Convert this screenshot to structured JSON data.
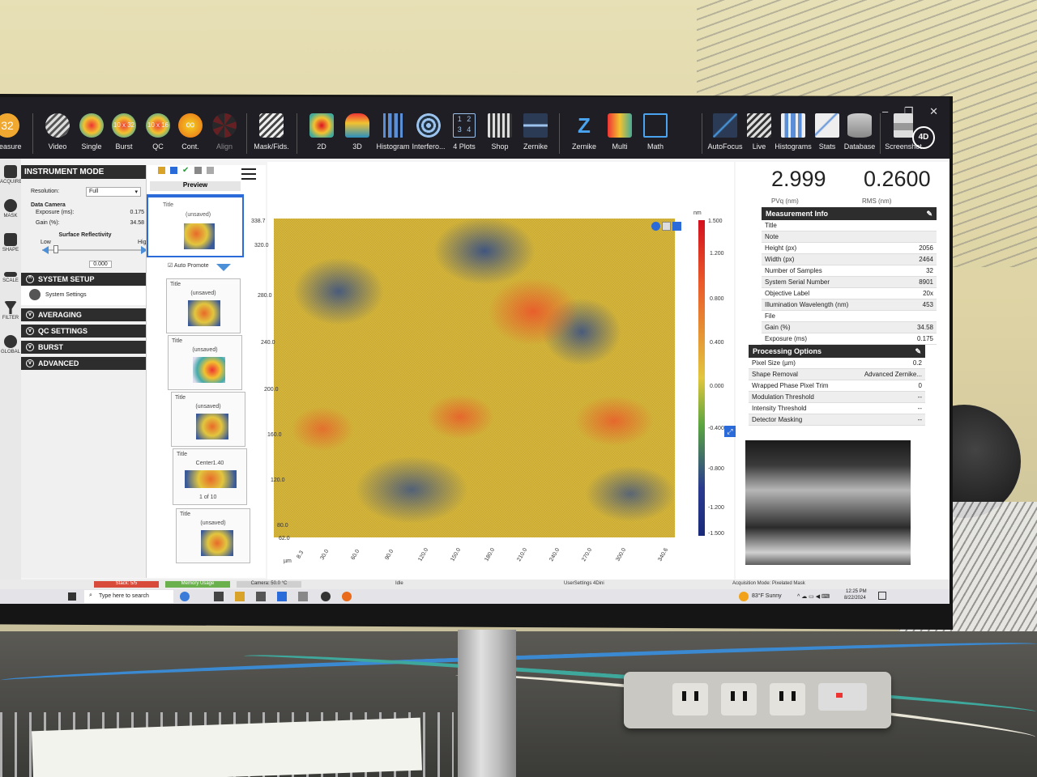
{
  "ribbon": {
    "left_counter": "32",
    "left_caption": "Measure",
    "groups": [
      {
        "label": "Video",
        "icon": "video-icon"
      },
      {
        "label": "Single",
        "icon": "single-icon"
      },
      {
        "label": "Burst",
        "icon": "burst-icon",
        "badge": "10 x 32"
      },
      {
        "label": "QC",
        "icon": "qc-icon",
        "badge": "10 x 16"
      },
      {
        "label": "Cont.",
        "icon": "continuous-icon",
        "badge": "∞"
      },
      {
        "label": "Align",
        "icon": "align-icon"
      },
      {
        "label": "Mask/Fids.",
        "icon": "mask-fids-icon"
      },
      {
        "label": "2D",
        "icon": "plot-2d-icon"
      },
      {
        "label": "3D",
        "icon": "plot-3d-icon"
      },
      {
        "label": "Histogram",
        "icon": "histogram-icon"
      },
      {
        "label": "Interfero...",
        "icon": "interferogram-icon"
      },
      {
        "label": "4 Plots",
        "icon": "four-plots-icon",
        "badge": "1 2 3 4"
      },
      {
        "label": "Shop",
        "icon": "shop-icon"
      },
      {
        "label": "Zernike",
        "icon": "zernike-plot-icon"
      },
      {
        "label": "Zernike",
        "icon": "zernike-z-icon",
        "badge": "Z"
      },
      {
        "label": "Multi",
        "icon": "multi-icon"
      },
      {
        "label": "Math",
        "icon": "math-icon"
      },
      {
        "label": "AutoFocus",
        "icon": "autofocus-icon"
      },
      {
        "label": "Live",
        "icon": "live-icon"
      },
      {
        "label": "Histograms",
        "icon": "histograms-icon"
      },
      {
        "label": "Stats",
        "icon": "stats-icon"
      },
      {
        "label": "Database",
        "icon": "database-icon"
      },
      {
        "label": "Screenshot",
        "icon": "screenshot-icon"
      }
    ],
    "window_controls": "– ❐ ✕",
    "logo": "4D"
  },
  "iconcol": [
    {
      "label": "ACQUIRE",
      "icon": "camera-icon"
    },
    {
      "label": "MASK",
      "icon": "mask-icon"
    },
    {
      "label": "SHAPE",
      "icon": "shape-icon"
    },
    {
      "label": "SCALE",
      "icon": "ruler-icon"
    },
    {
      "label": "FILTER",
      "icon": "filter-icon"
    },
    {
      "label": "GLOBAL",
      "icon": "globe-icon"
    }
  ],
  "instrument": {
    "title": "INSTRUMENT MODE",
    "resolution_label": "Resolution:",
    "resolution_value": "Full",
    "data_camera": "Data Camera",
    "exposure_label": "Exposure (ms):",
    "exposure_value": "0.175",
    "gain_label": "Gain (%):",
    "gain_value": "34.58",
    "surface_reflectivity": "Surface Reflectivity",
    "low": "Low",
    "high": "High",
    "reflectivity_value": "0.000",
    "sections": [
      {
        "label": "SYSTEM SETUP",
        "sub": "System Settings"
      },
      {
        "label": "AVERAGING"
      },
      {
        "label": "QC SETTINGS"
      },
      {
        "label": "BURST"
      },
      {
        "label": "ADVANCED"
      }
    ]
  },
  "preview": {
    "header": "Preview",
    "auto_promote": "Auto Promote",
    "items": [
      {
        "title": "Title",
        "state": "(unsaved)"
      },
      {
        "title": "Title",
        "state": "(unsaved)"
      },
      {
        "title": "Title",
        "state": "(unsaved)"
      },
      {
        "title": "Title",
        "state": "(unsaved)"
      },
      {
        "title": "Title",
        "state": "Center1.40",
        "footer": "1 of 10"
      },
      {
        "title": "Title",
        "state": "(unsaved)"
      }
    ]
  },
  "map": {
    "y_ticks": [
      "338.7",
      "320.0",
      "280.0",
      "240.0",
      "200.0",
      "160.0",
      "120.0",
      "80.0",
      "62.0"
    ],
    "x_ticks": [
      "8.3",
      "30.0",
      "60.0",
      "90.0",
      "120.0",
      "150.0",
      "180.0",
      "210.0",
      "240.0",
      "270.0",
      "300.0",
      "340.6"
    ],
    "x_unit": "µm",
    "cbar_unit": "nm",
    "cbar_ticks": [
      "1.500",
      "1.200",
      "0.800",
      "0.400",
      "0.000",
      "-0.400",
      "-0.800",
      "-1.200",
      "-1.500"
    ]
  },
  "stats": {
    "pv_value": "2.999",
    "pv_label": "PVq (nm)",
    "rms_value": "0.2600",
    "rms_label": "RMS (nm)"
  },
  "measurement_info": {
    "title": "Measurement Info",
    "rows": [
      {
        "k": "Title",
        "v": ""
      },
      {
        "k": "Note",
        "v": ""
      },
      {
        "k": "Height (px)",
        "v": "2056"
      },
      {
        "k": "Width (px)",
        "v": "2464"
      },
      {
        "k": "Number of Samples",
        "v": "32"
      },
      {
        "k": "System Serial Number",
        "v": "8901"
      },
      {
        "k": "Objective Label",
        "v": "20x"
      },
      {
        "k": "Illumination Wavelength (nm)",
        "v": "453"
      },
      {
        "k": "File",
        "v": ""
      },
      {
        "k": "Gain (%)",
        "v": "34.58"
      },
      {
        "k": "Exposure (ms)",
        "v": "0.175"
      }
    ]
  },
  "processing_options": {
    "title": "Processing Options",
    "rows": [
      {
        "k": "Pixel Size (µm)",
        "v": "0.2"
      },
      {
        "k": "Shape Removal",
        "v": "Advanced Zernike..."
      },
      {
        "k": "Wrapped Phase Pixel Trim",
        "v": "0"
      },
      {
        "k": "Modulation Threshold",
        "v": "--"
      },
      {
        "k": "Intensity Threshold",
        "v": "--"
      },
      {
        "k": "Detector Masking",
        "v": "--"
      }
    ]
  },
  "status": {
    "stack": "Stack: 5/5",
    "memory": "Memory Usage",
    "camera": "Camera: 50.0 °C",
    "idle": "Idle",
    "usersettings": "UserSettings 4Dini",
    "acq_mode": "Acquisition Mode: Pixelated Mask"
  },
  "taskbar": {
    "search_placeholder": "Type here to search",
    "weather": "83°F  Sunny",
    "time": "12:25 PM",
    "date": "8/22/2024"
  },
  "colors": {
    "ribbon_bg": "#1e1e24",
    "panel_header": "#2d2d2d",
    "status_red": "#d84a3a",
    "status_green": "#6ab04c"
  }
}
